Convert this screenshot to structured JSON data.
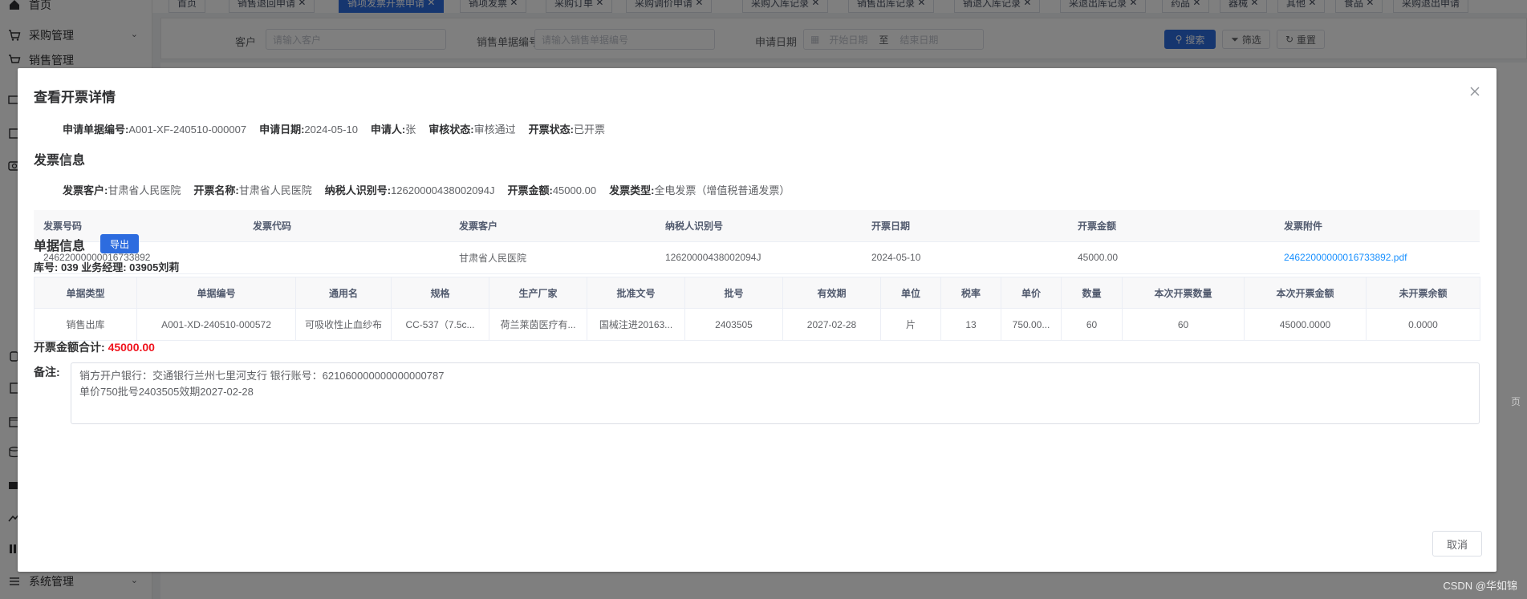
{
  "sidebar": {
    "items": [
      {
        "label": "首页",
        "icon": "home-icon"
      },
      {
        "label": "采购管理",
        "icon": "cart-icon"
      },
      {
        "label": "销售管理",
        "icon": "cart-icon"
      },
      {
        "label": "系统管理",
        "icon": "settings-sliders-icon"
      }
    ]
  },
  "tabs": [
    {
      "label": "首页"
    },
    {
      "label": "销售退回申请"
    },
    {
      "label": "销项发票开票申请"
    },
    {
      "label": "销项发票"
    },
    {
      "label": "采购订单"
    },
    {
      "label": "采购调价申请"
    },
    {
      "label": "采购入库记录"
    },
    {
      "label": "销售出库记录"
    },
    {
      "label": "销退入库记录"
    },
    {
      "label": "采退出库记录"
    },
    {
      "label": "药品"
    },
    {
      "label": "器械"
    },
    {
      "label": "其他"
    },
    {
      "label": "食品"
    },
    {
      "label": "采购退出申请"
    }
  ],
  "filter": {
    "customer_label": "客户",
    "customer_placeholder": "请输入客户",
    "order_label": "销售单据编号",
    "order_placeholder": "请输入销售单据编号",
    "date_label": "申请日期",
    "start_placeholder": "开始日期",
    "range_sep": "至",
    "end_placeholder": "结束日期",
    "search_label": "搜索",
    "filter_label": "筛选",
    "reset_label": "重置"
  },
  "dialog": {
    "title": "查看开票详情",
    "summary": [
      {
        "label": "申请单据编号:",
        "value": "A001-XF-240510-000007"
      },
      {
        "label": "申请日期:",
        "value": "2024-05-10"
      },
      {
        "label": "申请人:",
        "value": "张"
      },
      {
        "label": "审核状态:",
        "value": "审核通过"
      },
      {
        "label": "开票状态:",
        "value": "已开票"
      }
    ],
    "invoice_section_title": "发票信息",
    "invoice_summary": [
      {
        "label": "发票客户:",
        "value": "甘肃省人民医院"
      },
      {
        "label": "开票名称:",
        "value": "甘肃省人民医院"
      },
      {
        "label": "纳税人识别号:",
        "value": "12620000438002094J"
      },
      {
        "label": "开票金额:",
        "value": "45000.00"
      },
      {
        "label": "发票类型:",
        "value": "全电发票（增值税普通发票）"
      }
    ],
    "invoice_table": {
      "headers": [
        "发票号码",
        "发票代码",
        "发票客户",
        "纳税人识别号",
        "开票日期",
        "开票金额",
        "发票附件"
      ],
      "rows": [
        [
          "24622000000016733892",
          "",
          "甘肃省人民医院",
          "12620000438002094J",
          "2024-05-10",
          "45000.00",
          "24622000000016733892.pdf"
        ]
      ]
    },
    "doc_section_title": "单据信息",
    "export_label": "导出",
    "warehouse_line": "库号: 039    业务经理: 03905刘莉",
    "doc_table": {
      "headers": [
        "单据类型",
        "单据编号",
        "通用名",
        "规格",
        "生产厂家",
        "批准文号",
        "批号",
        "有效期",
        "单位",
        "税率",
        "单价",
        "数量",
        "本次开票数量",
        "本次开票金额",
        "未开票余额"
      ],
      "rows": [
        [
          "销售出库",
          "A001-XD-240510-000572",
          "可吸收性止血纱布",
          "CC-537（7.5c...",
          "荷兰莱茵医疗有...",
          "国械注进20163...",
          "2403505",
          "2027-02-28",
          "片",
          "13",
          "750.00...",
          "60",
          "60",
          "45000.0000",
          "0.0000"
        ]
      ]
    },
    "total_label": "开票金额合计: ",
    "total_value": "45000.00",
    "remark_label": "备注:",
    "remark_text": "销方开户银行：交通银行兰州七里河支行 银行账号：621060000000000000787\n单价750批号2403505效期2027-02-28",
    "cancel_label": "取消"
  },
  "page_hint": "页",
  "watermark": "CSDN @华如锦"
}
